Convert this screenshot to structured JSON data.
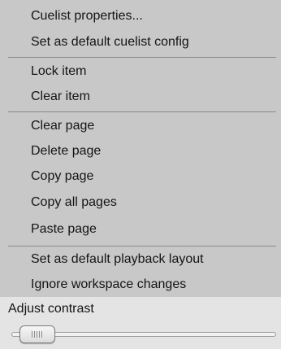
{
  "menu": {
    "group1": [
      {
        "label": "Cuelist properties..."
      },
      {
        "label": "Set as default cuelist config"
      }
    ],
    "group2": [
      {
        "label": "Lock item"
      },
      {
        "label": "Clear item"
      }
    ],
    "group3": [
      {
        "label": "Clear page"
      },
      {
        "label": "Delete page"
      },
      {
        "label": "Copy page"
      },
      {
        "label": "Copy all pages"
      },
      {
        "label": "Paste page"
      }
    ],
    "group4": [
      {
        "label": "Set as default playback layout"
      },
      {
        "label": "Ignore workspace changes"
      }
    ]
  },
  "contrast": {
    "label": "Adjust contrast",
    "value_fraction": 0.05
  }
}
